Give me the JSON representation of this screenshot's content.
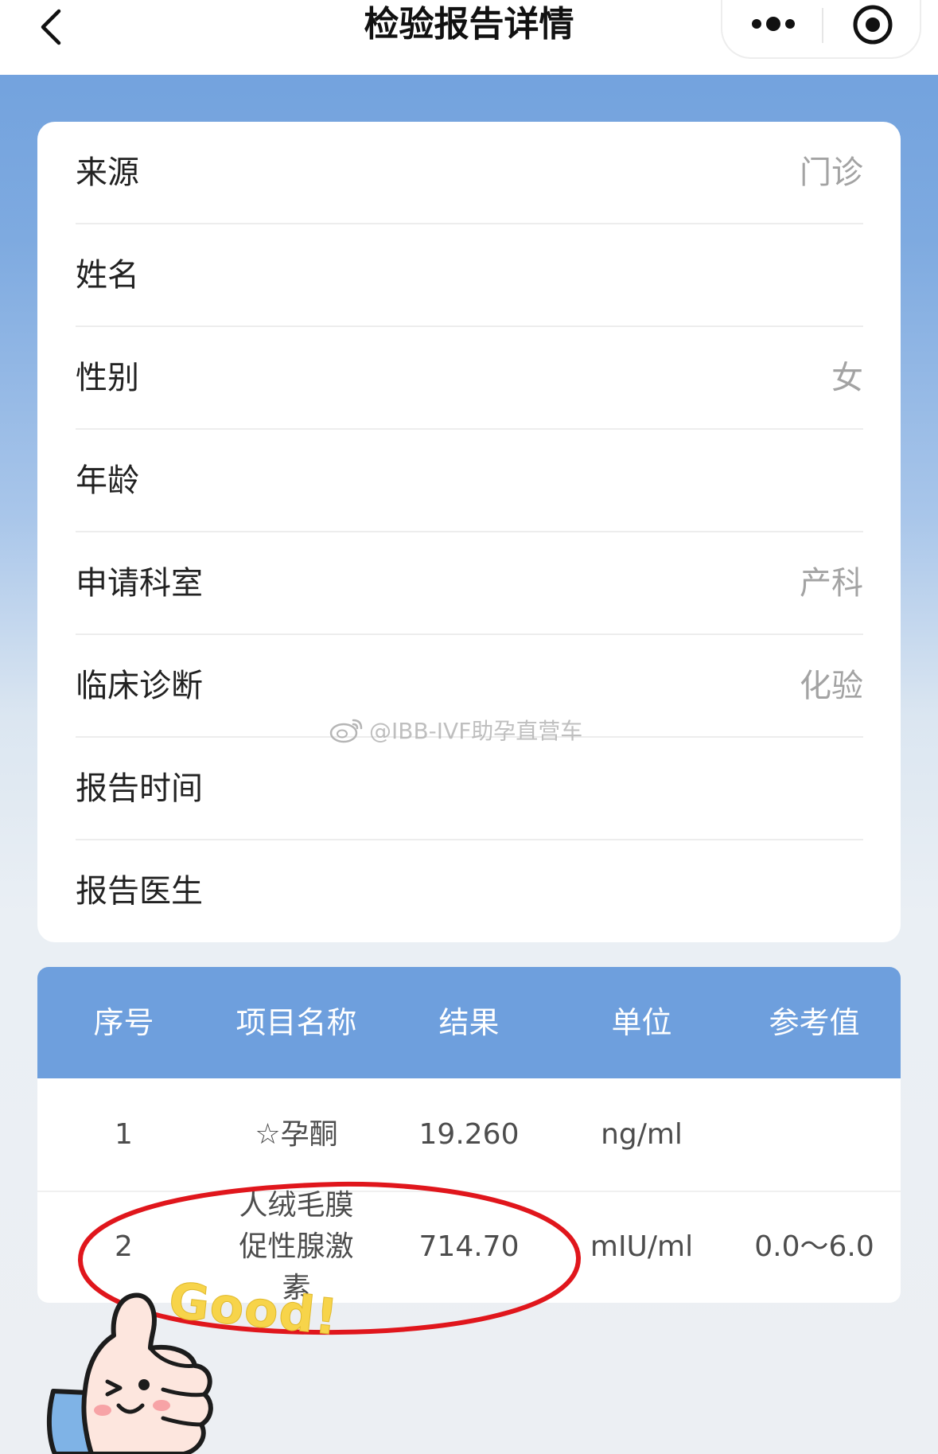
{
  "nav": {
    "title": "检验报告详情"
  },
  "info": {
    "rows": [
      {
        "label": "来源",
        "value": "门诊"
      },
      {
        "label": "姓名",
        "value": ""
      },
      {
        "label": "性别",
        "value": "女"
      },
      {
        "label": "年龄",
        "value": ""
      },
      {
        "label": "申请科室",
        "value": "产科"
      },
      {
        "label": "临床诊断",
        "value": "化验"
      },
      {
        "label": "报告时间",
        "value": ""
      },
      {
        "label": "报告医生",
        "value": ""
      }
    ]
  },
  "table": {
    "headers": [
      "序号",
      "项目名称",
      "结果",
      "单位",
      "参考值"
    ],
    "rows": [
      {
        "no": "1",
        "item": "☆孕酮",
        "result": "19.260",
        "unit": "ng/ml",
        "ref": ""
      },
      {
        "no": "2",
        "item": "人绒毛膜促性腺激素",
        "result": "714.70",
        "unit": "mIU/ml",
        "ref": "0.0～6.0"
      }
    ]
  },
  "watermark": {
    "text": "@IBB-IVF助孕直营车"
  },
  "sticker": {
    "text": "Good!"
  },
  "colors": {
    "accent": "#6e9fdd",
    "highlight": "#e0161c",
    "sticker_yellow": "#f7d44a"
  },
  "icons": {
    "back": "chevron-left-icon",
    "more": "more-dots-icon",
    "close": "target-circle-icon",
    "watermark": "weibo-icon"
  }
}
